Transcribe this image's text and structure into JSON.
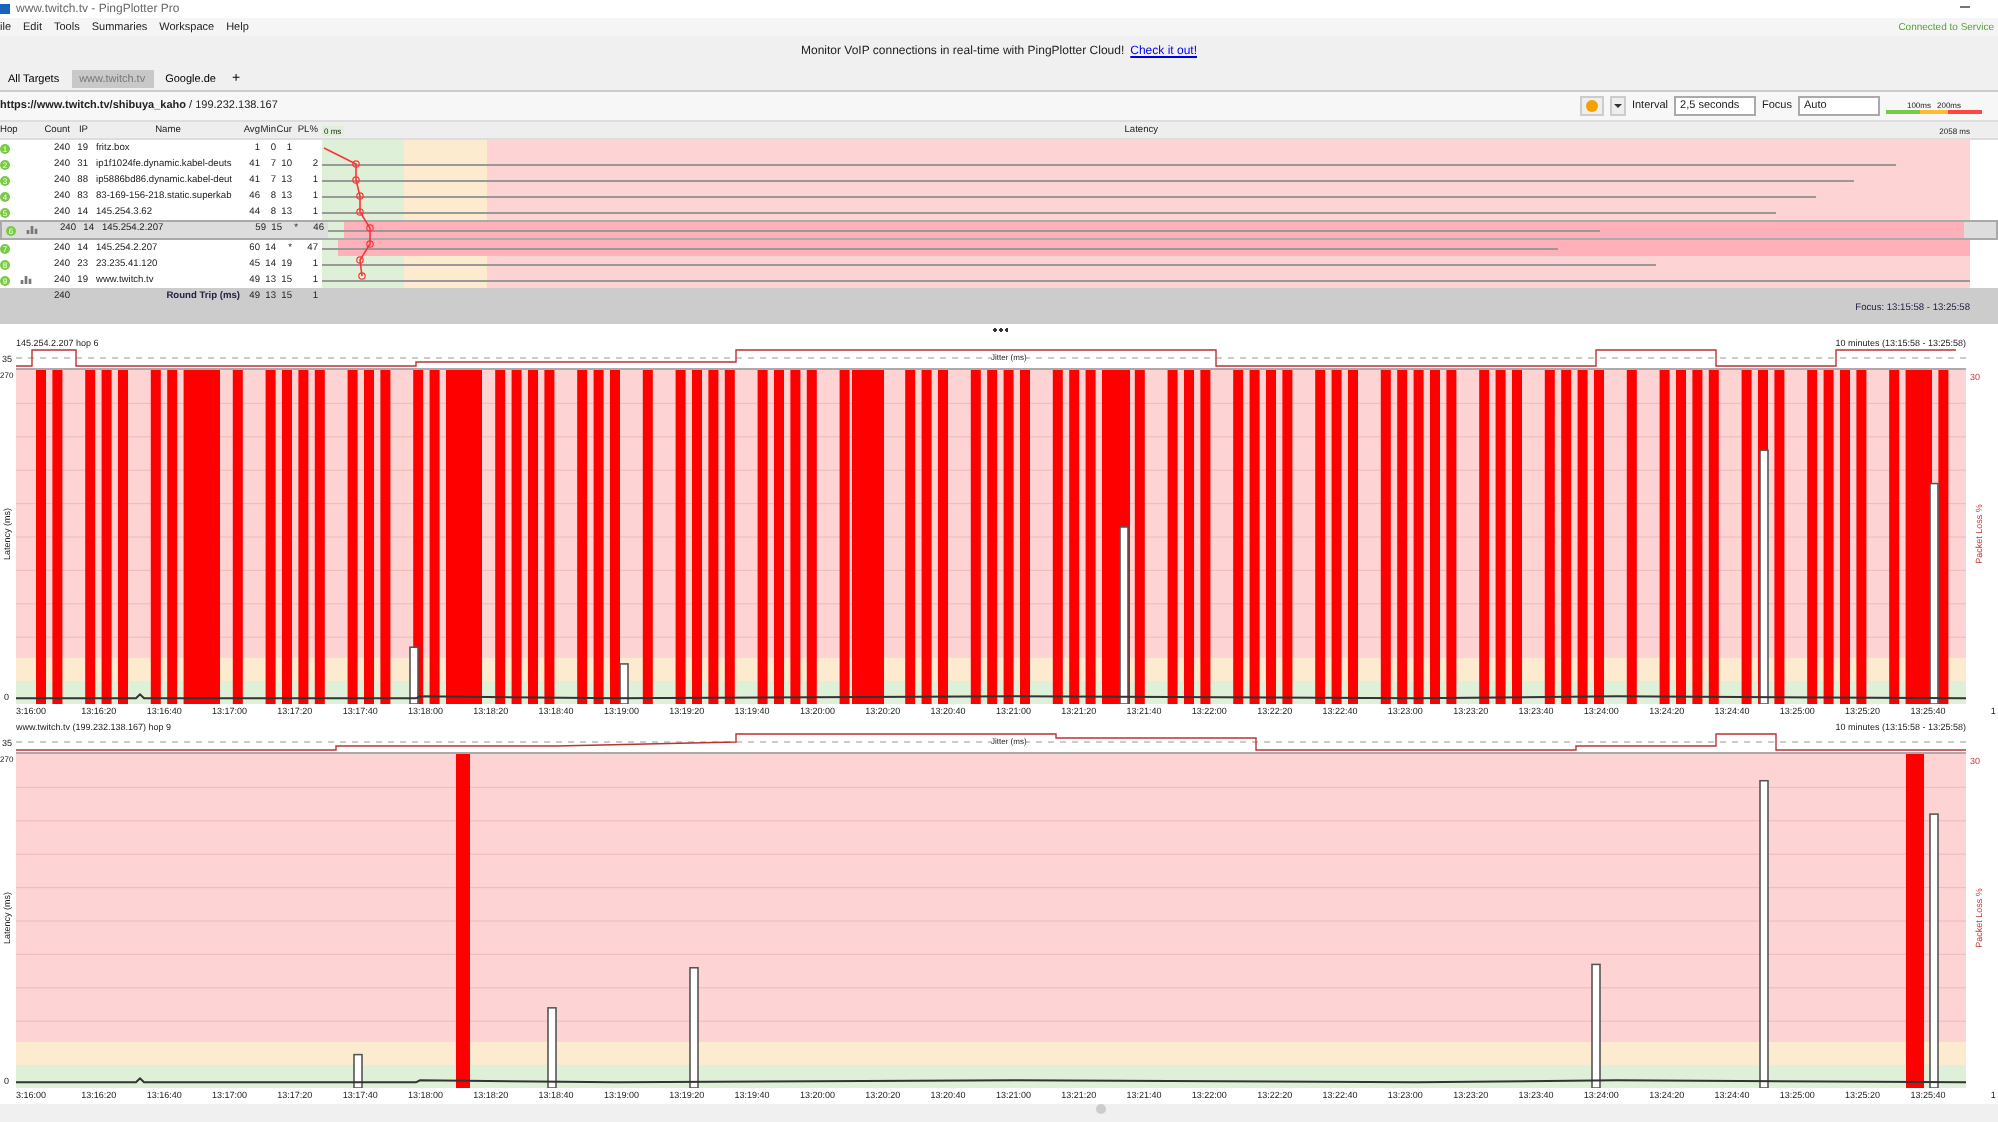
{
  "window": {
    "title": "www.twitch.tv - PingPlotter Pro"
  },
  "menu": [
    "ile",
    "Edit",
    "Tools",
    "Summaries",
    "Workspace",
    "Help"
  ],
  "service_status": "Connected to Service",
  "banner": {
    "text": "Monitor VoIP connections in real-time with PingPlotter Cloud!",
    "link": "Check it out!"
  },
  "tabs": [
    {
      "label": "All Targets",
      "selected": false
    },
    {
      "label": "www.twitch.tv",
      "selected": true
    },
    {
      "label": "Google.de",
      "selected": false
    }
  ],
  "add_tab": "+",
  "target": {
    "url": "https://www.twitch.tv/shibuya_kaho",
    "ip": "/ 199.232.138.167"
  },
  "toolbar": {
    "interval_label": "Interval",
    "interval": "2,5 seconds",
    "focus_label": "Focus",
    "focus": "Auto",
    "scale": [
      "100ms",
      "200ms"
    ]
  },
  "table": {
    "columns": [
      "Hop",
      "Count",
      "IP",
      "Name",
      "Avg",
      "Min",
      "Cur",
      "PL%"
    ],
    "latency_header": "Latency",
    "scale_min": "0 ms",
    "scale_max": "2058 ms",
    "rows": [
      {
        "hop": "1",
        "graph": false,
        "selected": false,
        "highlighted": false,
        "count": "240",
        "ip": "19",
        "name": "fritz.box",
        "avg": "1",
        "min": "0",
        "cur": "1",
        "pl": "",
        "level": 0
      },
      {
        "hop": "2",
        "graph": false,
        "selected": false,
        "highlighted": false,
        "count": "240",
        "ip": "31",
        "name": "ip1f1024fe.dynamic.kabel-deuts",
        "avg": "41",
        "min": "7",
        "cur": "10",
        "pl": "2",
        "level": 0.955
      },
      {
        "hop": "3",
        "graph": false,
        "selected": false,
        "highlighted": false,
        "count": "240",
        "ip": "88",
        "name": "ip5886bd86.dynamic.kabel-deut",
        "avg": "41",
        "min": "7",
        "cur": "13",
        "pl": "1",
        "level": 0.93
      },
      {
        "hop": "4",
        "graph": false,
        "selected": false,
        "highlighted": false,
        "count": "240",
        "ip": "83",
        "name": "83-169-156-218.static.superkab",
        "avg": "46",
        "min": "8",
        "cur": "13",
        "pl": "1",
        "level": 0.906
      },
      {
        "hop": "5",
        "graph": false,
        "selected": false,
        "highlighted": false,
        "count": "240",
        "ip": "14",
        "name": "145.254.3.62",
        "avg": "44",
        "min": "8",
        "cur": "13",
        "pl": "1",
        "level": 0.882
      },
      {
        "hop": "6",
        "graph": true,
        "selected": true,
        "highlighted": true,
        "count": "240",
        "ip": "14",
        "name": "145.254.2.207",
        "avg": "59",
        "min": "15",
        "cur": "*",
        "pl": "46",
        "level": 0.777
      },
      {
        "hop": "7",
        "graph": false,
        "selected": false,
        "highlighted": true,
        "count": "240",
        "ip": "14",
        "name": "145.254.2.207",
        "avg": "60",
        "min": "14",
        "cur": "*",
        "pl": "47",
        "level": 0.75
      },
      {
        "hop": "8",
        "graph": false,
        "selected": false,
        "highlighted": false,
        "count": "240",
        "ip": "23",
        "name": "23.235.41.120",
        "avg": "45",
        "min": "14",
        "cur": "19",
        "pl": "1",
        "level": 0.81
      },
      {
        "hop": "9",
        "graph": true,
        "selected": false,
        "highlighted": false,
        "count": "240",
        "ip": "19",
        "name": "www.twitch.tv",
        "avg": "49",
        "min": "13",
        "cur": "15",
        "pl": "1",
        "level": 1.0
      }
    ],
    "footer": {
      "count": "240",
      "label": "Round Trip (ms)",
      "avg": "49",
      "min": "13",
      "cur": "15",
      "pl": "1"
    }
  },
  "focus_range": "Focus: 13:15:58 - 13:25:58",
  "graphs": [
    {
      "title": "145.254.2.207 hop 6",
      "range": "10 minutes (13:15:58 - 13:25:58)",
      "jitter_label": "Jitter (ms)",
      "jitter_max": "35",
      "y_max": "270",
      "y_min": "0",
      "y_label": "Latency (ms)",
      "loss_max": "30",
      "loss_label": "Packet Loss %",
      "x_labels": [
        "3:16:00",
        "13:16:20",
        "13:16:40",
        "13:17:00",
        "13:17:20",
        "13:17:40",
        "13:18:00",
        "13:18:20",
        "13:18:40",
        "13:19:00",
        "13:19:20",
        "13:19:40",
        "13:20:00",
        "13:20:20",
        "13:20:40",
        "13:21:00",
        "13:21:20",
        "13:21:40",
        "13:22:00",
        "13:22:20",
        "13:22:40",
        "13:23:00",
        "13:23:20",
        "13:23:40",
        "13:24:00",
        "13:24:20",
        "13:24:40",
        "13:25:00",
        "13:25:20",
        "13:25:40",
        "1"
      ]
    },
    {
      "title": "www.twitch.tv (199.232.138.167) hop 9",
      "range": "10 minutes (13:15:58 - 13:25:58)",
      "jitter_label": "Jitter (ms)",
      "jitter_max": "35",
      "y_max": "270",
      "y_min": "0",
      "y_label": "Latency (ms)",
      "loss_max": "30",
      "loss_label": "Packet Loss %",
      "x_labels": [
        "3:16:00",
        "13:16:20",
        "13:16:40",
        "13:17:00",
        "13:17:20",
        "13:17:40",
        "13:18:00",
        "13:18:20",
        "13:18:40",
        "13:19:00",
        "13:19:20",
        "13:19:40",
        "13:20:00",
        "13:20:20",
        "13:20:40",
        "13:21:00",
        "13:21:20",
        "13:21:40",
        "13:22:00",
        "13:22:20",
        "13:22:40",
        "13:23:00",
        "13:23:20",
        "13:23:40",
        "13:24:00",
        "13:24:20",
        "13:24:40",
        "13:25:00",
        "13:25:20",
        "13:25:40",
        "1"
      ]
    }
  ]
}
